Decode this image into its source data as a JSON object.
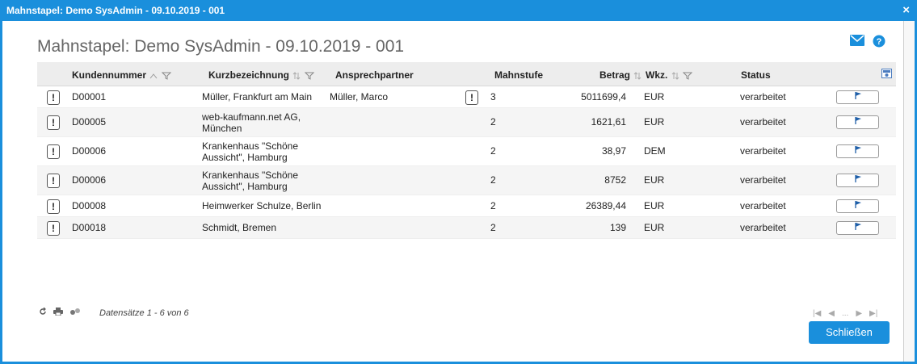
{
  "window": {
    "title": "Mahnstapel: Demo SysAdmin - 09.10.2019 - 001",
    "close_glyph": "×"
  },
  "page": {
    "title": "Mahnstapel: Demo SysAdmin - 09.10.2019 - 001"
  },
  "columns": {
    "kundennummer": "Kundennummer",
    "kurzbezeichnung": "Kurzbezeichnung",
    "ansprechpartner": "Ansprechpartner",
    "mahnstufe": "Mahnstufe",
    "betrag": "Betrag",
    "wkz": "Wkz.",
    "status": "Status"
  },
  "rows": [
    {
      "kundennummer": "D00001",
      "kurz1": "Müller, Frankfurt am Main",
      "kurz2": "",
      "ansprech": "Müller, Marco",
      "mahnstufe": "3",
      "betrag": "5011699,4",
      "wkz": "EUR",
      "status": "verarbeitet"
    },
    {
      "kundennummer": "D00005",
      "kurz1": "web-kaufmann.net AG,",
      "kurz2": "München",
      "ansprech": "",
      "mahnstufe": "2",
      "betrag": "1621,61",
      "wkz": "EUR",
      "status": "verarbeitet"
    },
    {
      "kundennummer": "D00006",
      "kurz1": "Krankenhaus \"Schöne",
      "kurz2": "Aussicht\", Hamburg",
      "ansprech": "",
      "mahnstufe": "2",
      "betrag": "38,97",
      "wkz": "DEM",
      "status": "verarbeitet"
    },
    {
      "kundennummer": "D00006",
      "kurz1": "Krankenhaus \"Schöne",
      "kurz2": "Aussicht\", Hamburg",
      "ansprech": "",
      "mahnstufe": "2",
      "betrag": "8752",
      "wkz": "EUR",
      "status": "verarbeitet"
    },
    {
      "kundennummer": "D00008",
      "kurz1": "Heimwerker Schulze, Berlin",
      "kurz2": "",
      "ansprech": "",
      "mahnstufe": "2",
      "betrag": "26389,44",
      "wkz": "EUR",
      "status": "verarbeitet"
    },
    {
      "kundennummer": "D00018",
      "kurz1": "Schmidt, Bremen",
      "kurz2": "",
      "ansprech": "",
      "mahnstufe": "2",
      "betrag": "139",
      "wkz": "EUR",
      "status": "verarbeitet"
    }
  ],
  "warn_glyph": "!",
  "footer": {
    "records": "Datensätze 1 - 6 von 6",
    "pager_ellipsis": "...",
    "close_label": "Schließen"
  },
  "icons": [
    "close-icon",
    "mail-icon",
    "help-icon",
    "sort-icon",
    "filter-icon",
    "column-chooser-icon",
    "warning-icon",
    "flag-icon",
    "refresh-icon",
    "print-icon",
    "export-icon",
    "first-page-icon",
    "prev-page-icon",
    "next-page-icon",
    "last-page-icon"
  ],
  "colors": {
    "accent": "#1a8fdc",
    "header_bg": "#ededed",
    "alt_row": "#f5f5f5"
  }
}
